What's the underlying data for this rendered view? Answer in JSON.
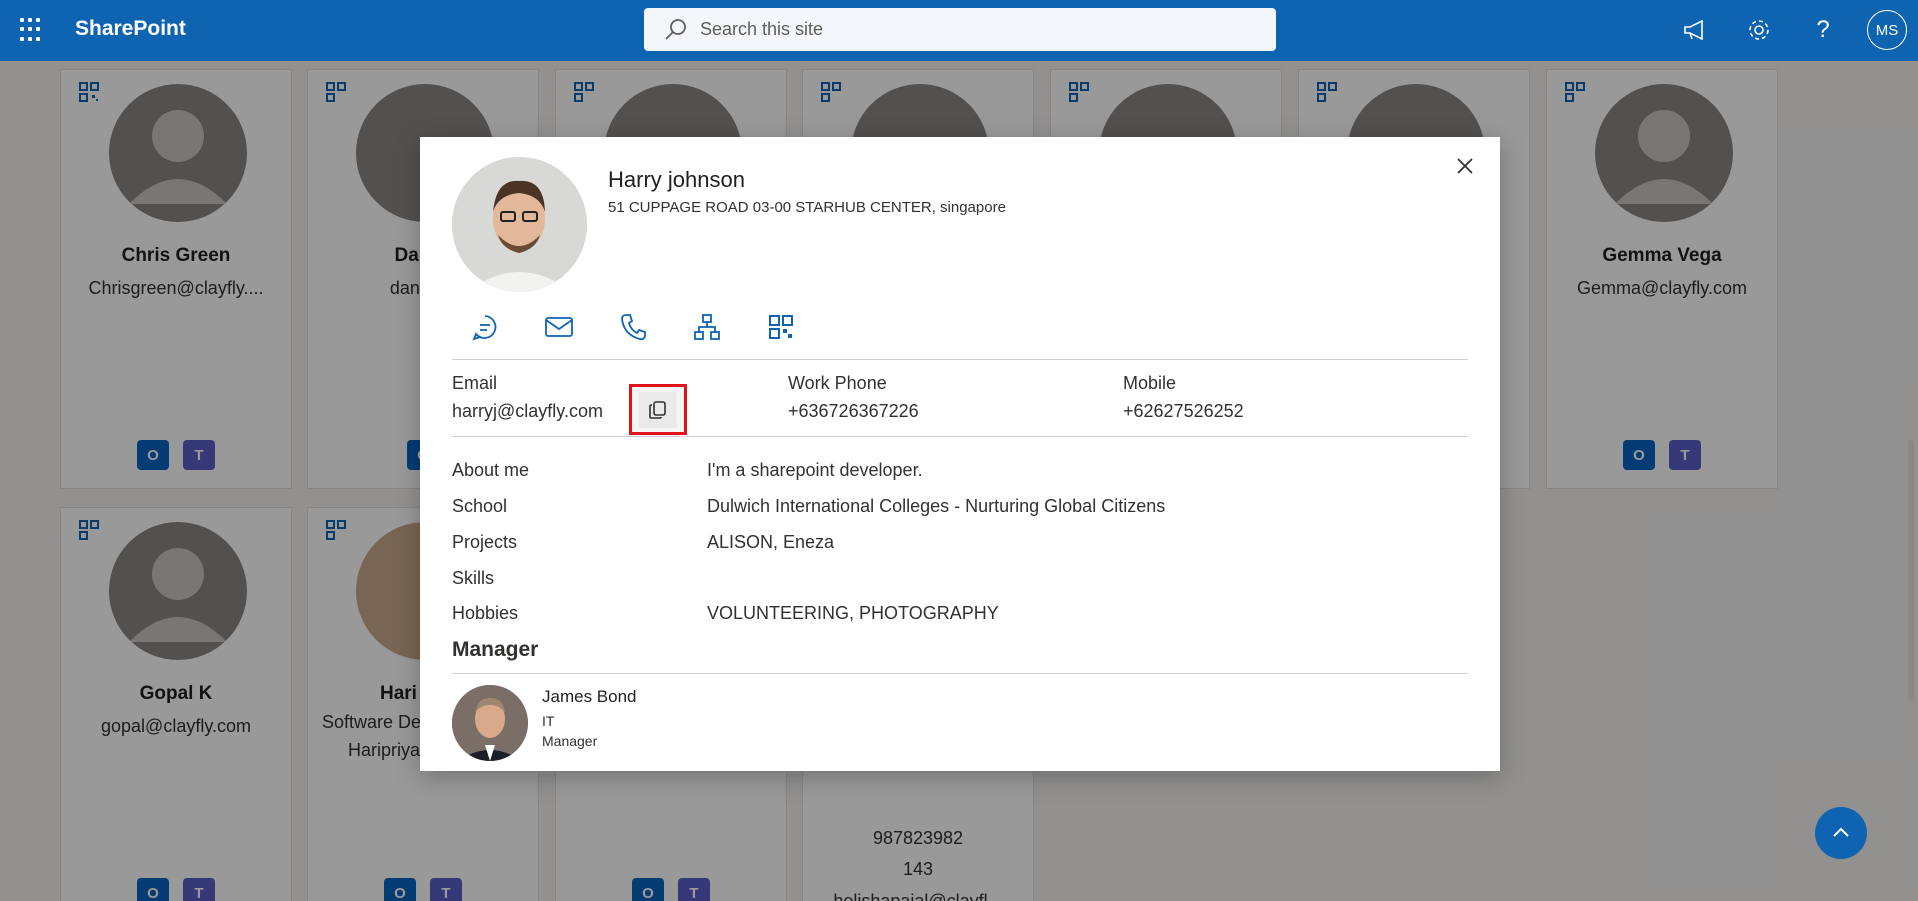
{
  "suitebar": {
    "app_name": "SharePoint",
    "search_placeholder": "Search this site",
    "user_initials": "MS"
  },
  "cards_row1": [
    {
      "name": "Chris Green",
      "email": "Chrisgreen@clayfly...."
    },
    {
      "name": "Daniel",
      "email": "daniel@"
    },
    {
      "name": "",
      "email": ""
    },
    {
      "name": "",
      "email": ""
    },
    {
      "name": "",
      "email": ""
    },
    {
      "name": "",
      "email": ""
    },
    {
      "name": "Gemma Vega",
      "email": "Gemma@clayfly.com"
    }
  ],
  "cards_row2": [
    {
      "name": "Gopal K",
      "email": "gopal@clayfly.com"
    },
    {
      "name": "Hari",
      "subtitle": "Software De",
      "email": "Haripriya"
    },
    {
      "name": "",
      "email": ""
    },
    {
      "name": "",
      "phone": "987823982",
      "ext": "143",
      "email": "helishapajal@clayfl..."
    }
  ],
  "modal": {
    "name": "Harry johnson",
    "address": "51 CUPPAGE ROAD 03-00 STARHUB CENTER, singapore",
    "contact": {
      "email_label": "Email",
      "email_value": "harryj@clayfly.com",
      "work_phone_label": "Work Phone",
      "work_phone_value": "+636726367226",
      "mobile_label": "Mobile",
      "mobile_value": "+62627526252"
    },
    "details": [
      {
        "label": "About me",
        "value": "I'm a sharepoint developer."
      },
      {
        "label": "School",
        "value": "Dulwich International Colleges - Nurturing Global Citizens"
      },
      {
        "label": "Projects",
        "value": "ALISON, Eneza"
      },
      {
        "label": "Skills",
        "value": ""
      },
      {
        "label": "Hobbies",
        "value": "VOLUNTEERING, PHOTOGRAPHY"
      }
    ],
    "manager_heading": "Manager",
    "manager": {
      "name": "James Bond",
      "department": "IT",
      "title": "Manager"
    }
  },
  "colors": {
    "suitebar": "#0f64b2",
    "accent": "#0f64b2",
    "highlight": "#e0131d"
  }
}
